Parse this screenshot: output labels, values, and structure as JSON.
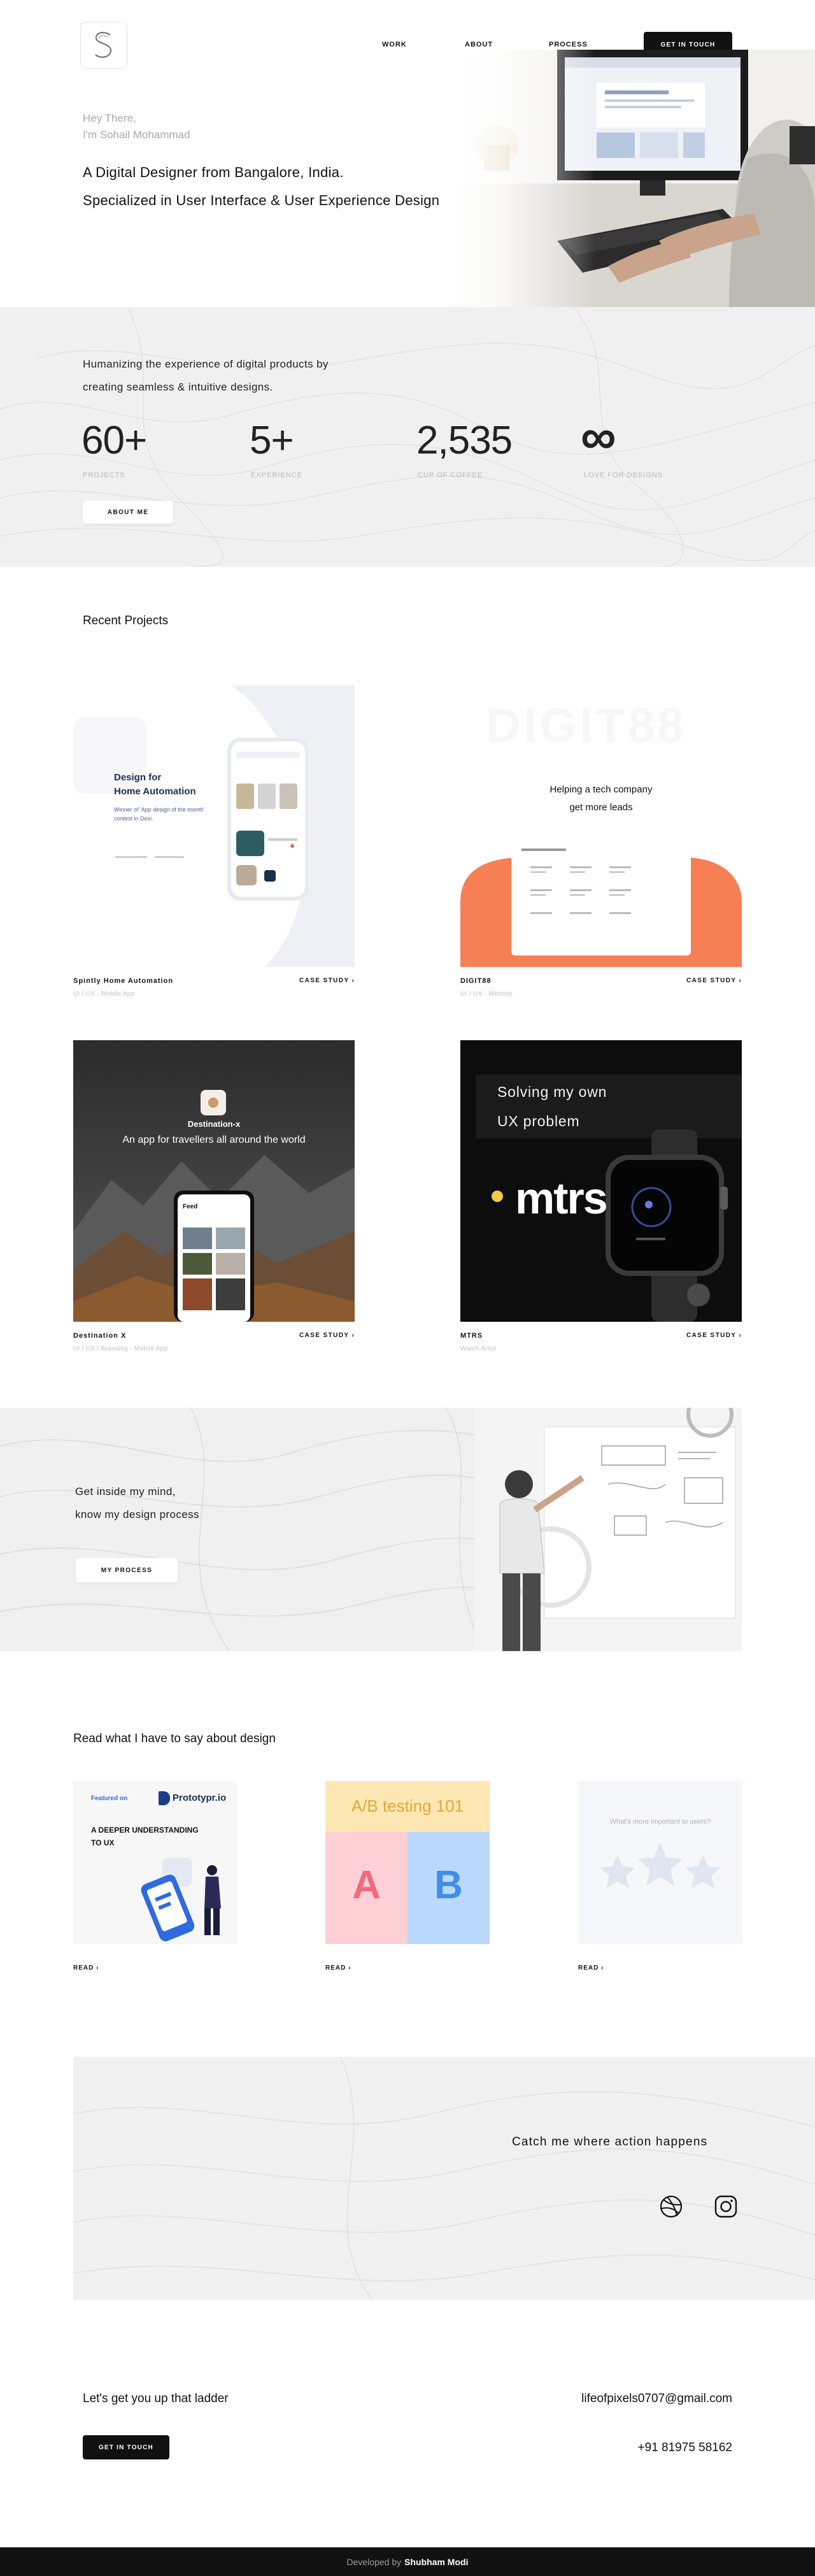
{
  "nav": {
    "links": [
      "WORK",
      "ABOUT",
      "PROCESS"
    ],
    "cta": "GET IN TOUCH"
  },
  "hero": {
    "greeting": "Hey There,",
    "name": "I'm Sohail Mohammad",
    "title_line1": "A Digital Designer from Bangalore, India.",
    "title_line2": "Specialized in User Interface & User Experience Design"
  },
  "stats": {
    "tagline_line1": "Humanizing the experience of digital products by",
    "tagline_line2": "creating seamless & intuitive designs.",
    "items": [
      {
        "value": "60+",
        "label": "PROJECTS"
      },
      {
        "value": "5+",
        "label": "EXPERIENCE"
      },
      {
        "value": "2,535",
        "label": "CUP OF COFFEE"
      },
      {
        "value": "∞",
        "label": "LOVE FOR DESIGNS"
      }
    ],
    "button": "ABOUT ME"
  },
  "projects": {
    "heading": "Recent Projects",
    "case_label": "CASE STUDY",
    "items": [
      {
        "name": "Spintly Home Automation",
        "sub": "UI / UX - Mobile App",
        "art_title": "Design for\nHome Automation",
        "art_sub": "Winner of 'App design of the month' contest in Dexi."
      },
      {
        "name": "DIGIT88",
        "sub": "UI / UX - Website",
        "art_title": "Helping a tech company\nget more leads",
        "art_bg_text": "DIGIT88"
      },
      {
        "name": "Destination X",
        "sub": "UI / UX / Branding - Mobile App",
        "art_title": "Destination-x",
        "art_sub": "An app for travellers all around the world",
        "art_feed": "Feed"
      },
      {
        "name": "MTRS",
        "sub": "Watch Artist",
        "art_title_line1": "Solving my own",
        "art_title_line2": "UX problem",
        "art_logo": "mtrs"
      }
    ]
  },
  "process": {
    "line1": "Get inside my mind,",
    "line2": "know my design process",
    "button": "MY PROCESS"
  },
  "articles": {
    "heading": "Read what I have to say about design",
    "read_label": "READ",
    "items": [
      {
        "featured": "Featured on",
        "brand": "Prototypr.io",
        "title_line1": "A DEEPER UNDERSTANDING",
        "title_line2": "TO UX"
      },
      {
        "title": "A/B testing 101",
        "a": "A",
        "b": "B"
      },
      {
        "question": "What's more important to users?"
      }
    ]
  },
  "social": {
    "heading": "Catch me where action happens",
    "icons": [
      "dribbble-icon",
      "instagram-icon"
    ]
  },
  "contact": {
    "line": "Let's get you up that ladder",
    "button": "GET IN TOUCH",
    "email": "lifeofpixels0707@gmail.com",
    "phone": "+91 81975 58162"
  },
  "footer": {
    "prefix": "Developed by",
    "author": "Shubham Modi"
  },
  "colors": {
    "accent_dark": "#111111",
    "band_gray": "#f0f0f0",
    "digit88_orange": "#f77f55",
    "ab_yellow": "#fde8b4",
    "ab_pink": "#fdd0d6",
    "ab_blue": "#b9d8fb"
  }
}
